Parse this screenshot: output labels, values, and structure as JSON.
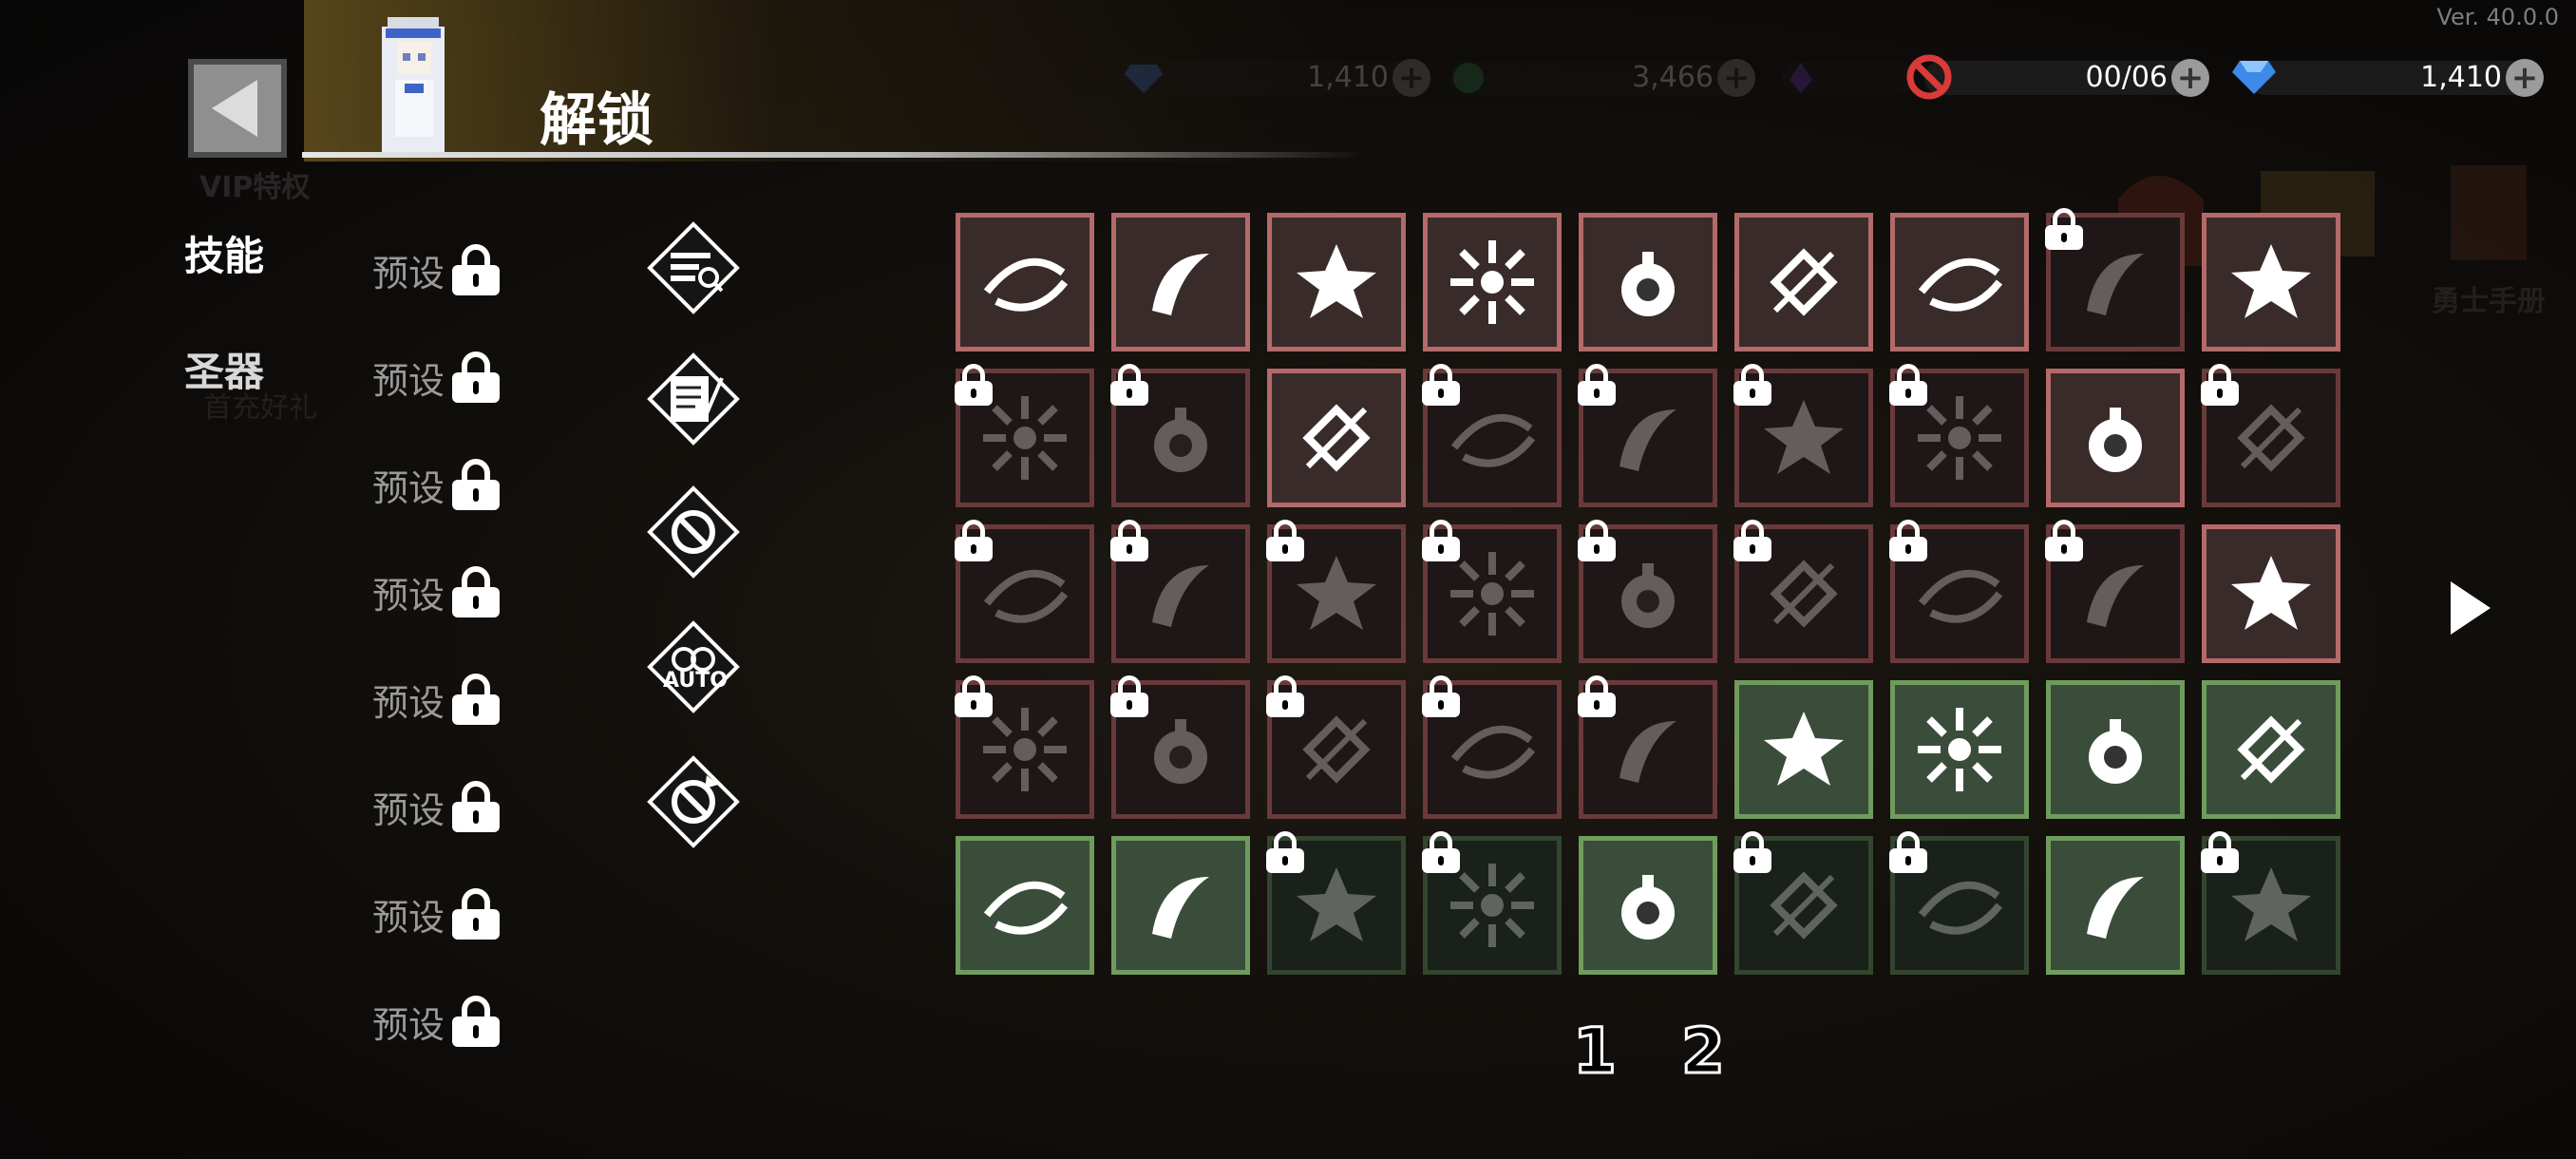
{
  "version": "Ver. 40.0.0",
  "header": {
    "title": "解锁",
    "vip_label": "VIP特权"
  },
  "resources": [
    {
      "name": "gem-dim",
      "value": "1,410"
    },
    {
      "name": "green-coin-dim",
      "value": "3,466"
    },
    {
      "name": "purple-dim",
      "value": ""
    },
    {
      "name": "ticket",
      "value": "00/06"
    },
    {
      "name": "gem",
      "value": "1,410"
    }
  ],
  "side_shop": {
    "label": "勇士手册"
  },
  "tabs": [
    {
      "label": "技能"
    },
    {
      "label": "圣器"
    }
  ],
  "gift_label": "首充好礼",
  "presets": [
    {
      "label": "预设"
    },
    {
      "label": "预设"
    },
    {
      "label": "预设"
    },
    {
      "label": "预设"
    },
    {
      "label": "预设"
    },
    {
      "label": "预设"
    },
    {
      "label": "预设"
    },
    {
      "label": "预设"
    }
  ],
  "tools": [
    {
      "icon": "search-list-icon"
    },
    {
      "icon": "scroll-quill-icon"
    },
    {
      "icon": "ban-icon"
    },
    {
      "icon": "auto-ring-icon",
      "text": "AUTO"
    },
    {
      "icon": "ban-refresh-icon"
    }
  ],
  "colors": {
    "red_border": "#b46a6a",
    "green_border": "#6f9c5d",
    "red_bg": "#3a2b2b",
    "green_bg": "#3a4d3a"
  },
  "skills": [
    {
      "icon": "slash-arc",
      "color": "red",
      "locked": false
    },
    {
      "icon": "blade-swirl",
      "color": "red",
      "locked": false
    },
    {
      "icon": "burst-rock",
      "color": "red",
      "locked": false
    },
    {
      "icon": "spark-star",
      "color": "red",
      "locked": false
    },
    {
      "icon": "arrows-up-down",
      "color": "red",
      "locked": false
    },
    {
      "icon": "frost-bomb",
      "color": "red",
      "locked": false
    },
    {
      "icon": "fire-bomb",
      "color": "red",
      "locked": false
    },
    {
      "icon": "dark-vortex",
      "color": "red",
      "locked": true
    },
    {
      "icon": "arrow-rain",
      "color": "red",
      "locked": false
    },
    {
      "icon": "biohazard",
      "color": "red",
      "locked": true
    },
    {
      "icon": "crescent",
      "color": "red",
      "locked": true
    },
    {
      "icon": "wind-slash",
      "color": "red",
      "locked": false
    },
    {
      "icon": "feather",
      "color": "red",
      "locked": true
    },
    {
      "icon": "crosshair",
      "color": "red",
      "locked": true
    },
    {
      "icon": "ice-sword",
      "color": "red",
      "locked": true
    },
    {
      "icon": "spiral",
      "color": "red",
      "locked": true
    },
    {
      "icon": "target-bomb",
      "color": "red",
      "locked": false
    },
    {
      "icon": "thorn-vine",
      "color": "red",
      "locked": true
    },
    {
      "icon": "smoke-cloud",
      "color": "red",
      "locked": true
    },
    {
      "icon": "fist",
      "color": "red",
      "locked": true
    },
    {
      "icon": "orbit",
      "color": "red",
      "locked": true
    },
    {
      "icon": "claw-slash",
      "color": "red",
      "locked": true
    },
    {
      "icon": "lightning-bomb",
      "color": "red",
      "locked": true
    },
    {
      "icon": "double-slash",
      "color": "red",
      "locked": true
    },
    {
      "icon": "spear-thrust",
      "color": "red",
      "locked": true
    },
    {
      "icon": "cross-slash",
      "color": "red",
      "locked": true
    },
    {
      "icon": "pulse-wave",
      "color": "red",
      "locked": false
    },
    {
      "icon": "fire-orb",
      "color": "red",
      "locked": true
    },
    {
      "icon": "ground-spikes",
      "color": "red",
      "locked": true
    },
    {
      "icon": "claw-rise",
      "color": "red",
      "locked": true
    },
    {
      "icon": "jaw-trap",
      "color": "red",
      "locked": true
    },
    {
      "icon": "compass-star",
      "color": "red",
      "locked": true
    },
    {
      "icon": "shard-strike",
      "color": "green",
      "locked": false
    },
    {
      "icon": "dice-chain",
      "color": "green",
      "locked": false
    },
    {
      "icon": "lightning-bolt",
      "color": "green",
      "locked": false
    },
    {
      "icon": "totem",
      "color": "green",
      "locked": false
    },
    {
      "icon": "fire-wheel",
      "color": "green",
      "locked": false
    },
    {
      "icon": "skull-burst",
      "color": "green",
      "locked": false
    },
    {
      "icon": "biohazard",
      "color": "green",
      "locked": true
    },
    {
      "icon": "laser-beam",
      "color": "green",
      "locked": true
    },
    {
      "icon": "flame-drop",
      "color": "green",
      "locked": false
    },
    {
      "icon": "dragon-head",
      "color": "green",
      "locked": true
    },
    {
      "icon": "swords-rain",
      "color": "green",
      "locked": true
    },
    {
      "icon": "cracked-glass",
      "color": "green",
      "locked": false
    },
    {
      "icon": "splatter",
      "color": "green",
      "locked": true
    }
  ],
  "pages": [
    {
      "label": "1"
    },
    {
      "label": "2"
    }
  ]
}
